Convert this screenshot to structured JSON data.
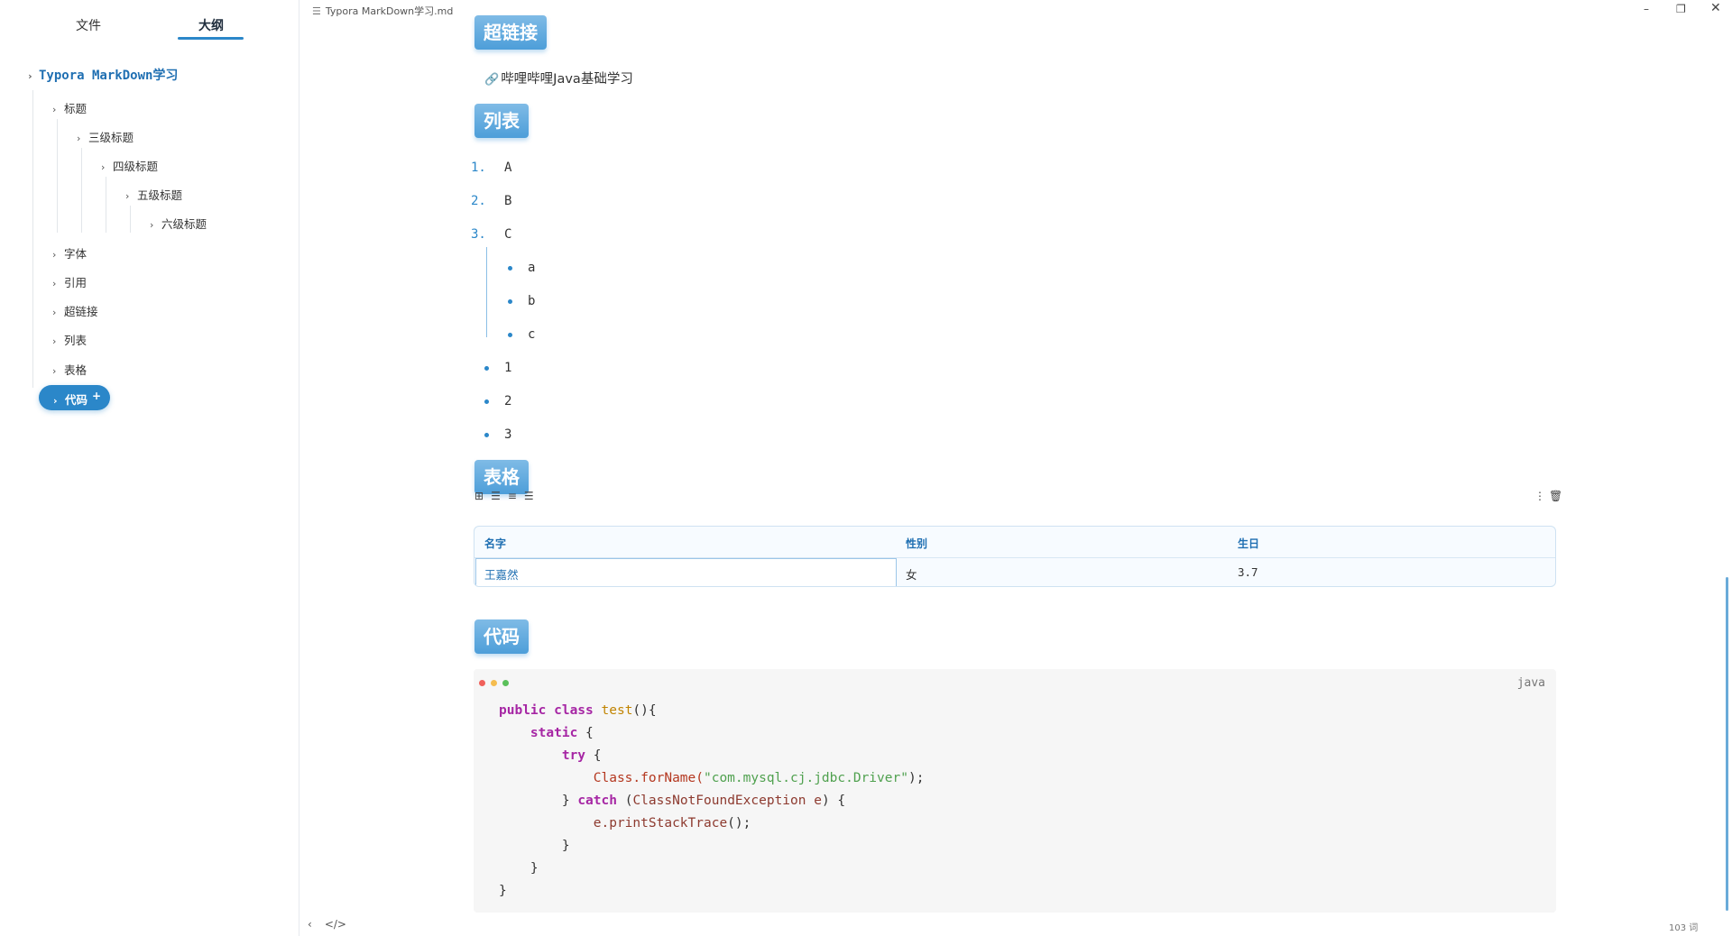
{
  "window": {
    "title": "Typora MarkDown学习.md",
    "controls": {
      "minimize": "–",
      "maximize": "❐",
      "close": "✕"
    }
  },
  "sidebar": {
    "tabs": [
      "文件",
      "大纲"
    ],
    "active_tab": "大纲",
    "root": "Typora MarkDown学习",
    "items": [
      {
        "label": "标题"
      },
      {
        "label": "三级标题"
      },
      {
        "label": "四级标题"
      },
      {
        "label": "五级标题"
      },
      {
        "label": "六级标题"
      },
      {
        "label": "字体"
      },
      {
        "label": "引用"
      },
      {
        "label": "超链接"
      },
      {
        "label": "列表"
      },
      {
        "label": "表格"
      }
    ],
    "active_item": "代码",
    "active_item_icon": "+"
  },
  "content": {
    "headings": {
      "hyperlink": "超链接",
      "list": "列表",
      "table": "表格",
      "code": "代码"
    },
    "link_text": "哔哩哔哩Java基础学习",
    "ordered_list": [
      {
        "num": "1.",
        "text": "A"
      },
      {
        "num": "2.",
        "text": "B"
      },
      {
        "num": "3.",
        "text": "C"
      }
    ],
    "nested_list": [
      "a",
      "b",
      "c"
    ],
    "bullet_list": [
      "1",
      "2",
      "3"
    ],
    "table": {
      "headers": [
        "名字",
        "性别",
        "生日"
      ],
      "rows": [
        [
          "王嘉然",
          "女",
          "3.7"
        ]
      ]
    },
    "code_block": {
      "language": "java",
      "lines": [
        "public class test(){",
        "    static {",
        "        try {",
        "            Class.forName(\"com.mysql.cj.jdbc.Driver\");",
        "        } catch (ClassNotFoundException e) {",
        "            e.printStackTrace();",
        "        }",
        "    }",
        "}"
      ]
    }
  },
  "status_bar": {
    "word_count": "103 词"
  },
  "colors": {
    "accent": "#2b87c9",
    "heading_bg": "#4d9ed9",
    "keyword": "#a626a4",
    "string": "#50a14f",
    "function": "#c18401"
  }
}
